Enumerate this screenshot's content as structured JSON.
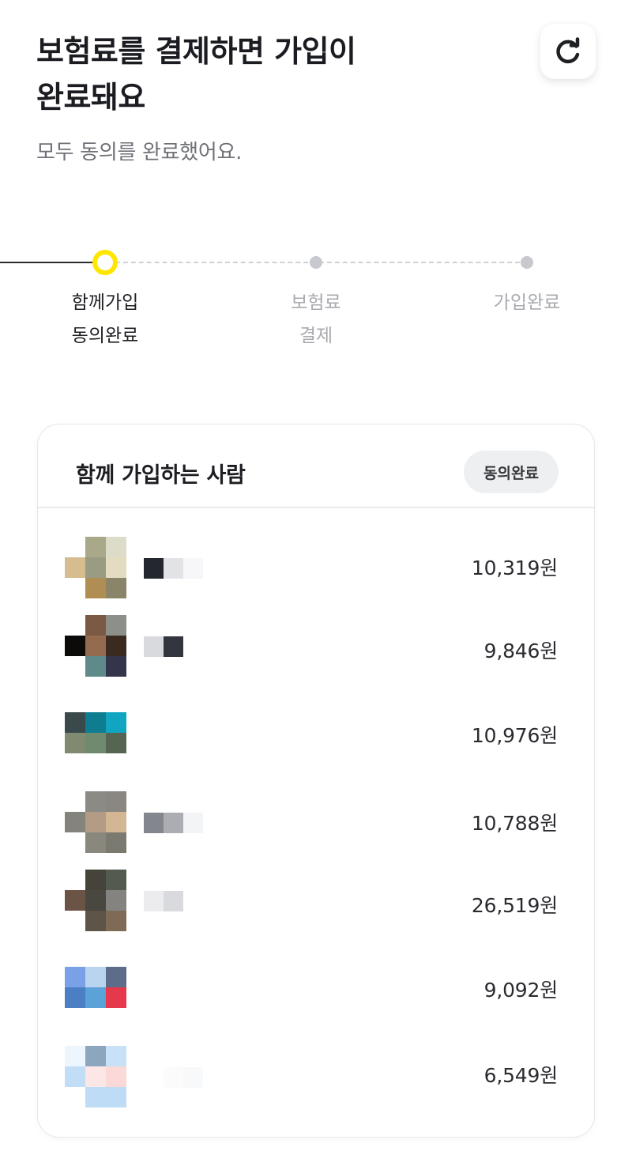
{
  "header": {
    "title_line1": "보험료를 결제하면 가입이",
    "title_line2": "완료돼요",
    "subtitle": "모두 동의를 완료했어요.",
    "refresh_icon": "refresh-icon"
  },
  "stepper": {
    "steps": [
      {
        "line1": "함께가입",
        "line2": "동의완료",
        "active": true
      },
      {
        "line1": "보험료",
        "line2": "결제",
        "active": false
      },
      {
        "line1": "가입완료",
        "line2": "",
        "active": false
      }
    ]
  },
  "members_card": {
    "title": "함께 가입하는 사람",
    "badge": "동의완료",
    "members": [
      {
        "amount": "10,319원"
      },
      {
        "amount": "9,846원"
      },
      {
        "amount": "10,976원"
      },
      {
        "amount": "10,788원"
      },
      {
        "amount": "26,519원"
      },
      {
        "amount": "9,092원"
      },
      {
        "amount": "6,549원"
      }
    ]
  },
  "colors": {
    "accent_yellow": "#ffe600",
    "text_primary": "#1b1c21",
    "text_secondary": "#6f7177",
    "inactive": "#c7c9ce"
  }
}
